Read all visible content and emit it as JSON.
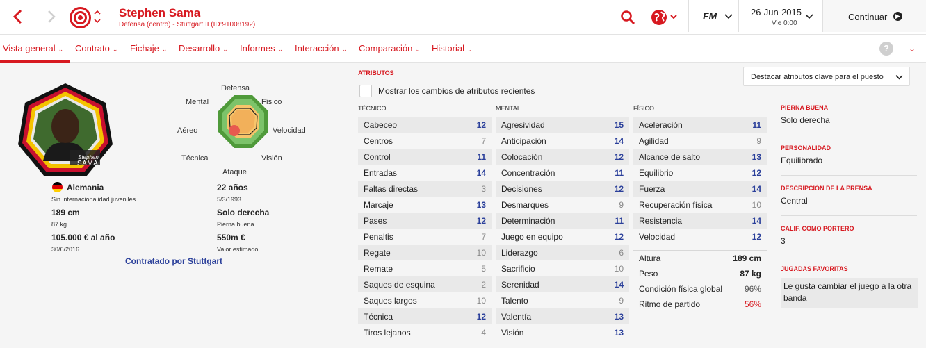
{
  "header": {
    "player_name": "Stephen Sama",
    "player_sub": "Defensa (centro) - Stuttgart II (ID:91008192)",
    "fm_label": "FM",
    "date": "26-Jun-2015",
    "day_time": "Vie 0:00",
    "continue_label": "Continuar"
  },
  "menu": {
    "items": [
      "Vista general",
      "Contrato",
      "Fichaje",
      "Desarrollo",
      "Informes",
      "Interacción",
      "Comparación",
      "Historial"
    ],
    "help": "?"
  },
  "profile": {
    "portrait_first": "Stephen",
    "portrait_last": "SAMA",
    "nationality": "Alemania",
    "youth_caps": "Sin internacionalidad juveniles",
    "height": "189 cm",
    "weight": "87 kg",
    "wage": "105.000 € al año",
    "contract_end": "30/6/2016",
    "age": "22 años",
    "dob": "5/3/1993",
    "foot": "Solo derecha",
    "foot_label": "Pierna buena",
    "value": "550m €",
    "value_label": "Valor estimado",
    "contracted": "Contratado por Stuttgart"
  },
  "radar": {
    "labels": {
      "defensa": "Defensa",
      "fisico": "Físico",
      "velocidad": "Velocidad",
      "vision": "Visión",
      "ataque": "Ataque",
      "tecnica": "Técnica",
      "aereo": "Aéreo",
      "mental": "Mental"
    }
  },
  "attributes": {
    "title": "ATRIBUTOS",
    "highlight_select": "Destacar atributos clave para el puesto",
    "show_changes": "Mostrar los cambios de atributos recientes",
    "technical_head": "TÉCNICO",
    "mental_head": "MENTAL",
    "physical_head": "FÍSICO",
    "technical": [
      {
        "name": "Cabeceo",
        "value": "12",
        "hl": true
      },
      {
        "name": "Centros",
        "value": "7",
        "hl": false
      },
      {
        "name": "Control",
        "value": "11",
        "hl": true
      },
      {
        "name": "Entradas",
        "value": "14",
        "hl": true
      },
      {
        "name": "Faltas directas",
        "value": "3",
        "hl": false
      },
      {
        "name": "Marcaje",
        "value": "13",
        "hl": true
      },
      {
        "name": "Pases",
        "value": "12",
        "hl": true
      },
      {
        "name": "Penaltis",
        "value": "7",
        "hl": false
      },
      {
        "name": "Regate",
        "value": "10",
        "hl": false
      },
      {
        "name": "Remate",
        "value": "5",
        "hl": false
      },
      {
        "name": "Saques de esquina",
        "value": "2",
        "hl": false
      },
      {
        "name": "Saques largos",
        "value": "10",
        "hl": false
      },
      {
        "name": "Técnica",
        "value": "12",
        "hl": true
      },
      {
        "name": "Tiros lejanos",
        "value": "4",
        "hl": false
      }
    ],
    "mental": [
      {
        "name": "Agresividad",
        "value": "15",
        "hl": true
      },
      {
        "name": "Anticipación",
        "value": "14",
        "hl": true
      },
      {
        "name": "Colocación",
        "value": "12",
        "hl": true
      },
      {
        "name": "Concentración",
        "value": "11",
        "hl": true
      },
      {
        "name": "Decisiones",
        "value": "12",
        "hl": true
      },
      {
        "name": "Desmarques",
        "value": "9",
        "hl": false
      },
      {
        "name": "Determinación",
        "value": "11",
        "hl": true
      },
      {
        "name": "Juego en equipo",
        "value": "12",
        "hl": true
      },
      {
        "name": "Liderazgo",
        "value": "6",
        "hl": false
      },
      {
        "name": "Sacrificio",
        "value": "10",
        "hl": false
      },
      {
        "name": "Serenidad",
        "value": "14",
        "hl": true
      },
      {
        "name": "Talento",
        "value": "9",
        "hl": false
      },
      {
        "name": "Valentía",
        "value": "13",
        "hl": true
      },
      {
        "name": "Visión",
        "value": "13",
        "hl": true
      }
    ],
    "physical": [
      {
        "name": "Aceleración",
        "value": "11",
        "hl": true
      },
      {
        "name": "Agilidad",
        "value": "9",
        "hl": false
      },
      {
        "name": "Alcance de salto",
        "value": "13",
        "hl": true
      },
      {
        "name": "Equilibrio",
        "value": "12",
        "hl": true
      },
      {
        "name": "Fuerza",
        "value": "14",
        "hl": true
      },
      {
        "name": "Recuperación física",
        "value": "10",
        "hl": false
      },
      {
        "name": "Resistencia",
        "value": "14",
        "hl": true
      },
      {
        "name": "Velocidad",
        "value": "12",
        "hl": true
      }
    ],
    "physical_extra": [
      {
        "name": "Altura",
        "value": "189 cm",
        "style": "dark"
      },
      {
        "name": "Peso",
        "value": "87 kg",
        "style": "dark"
      },
      {
        "name": "Condición física global",
        "value": "96%",
        "style": "norm"
      },
      {
        "name": "Ritmo de partido",
        "value": "56%",
        "style": "red"
      }
    ]
  },
  "right_info": {
    "foot_head": "PIERNA BUENA",
    "foot_val": "Solo derecha",
    "personality_head": "PERSONALIDAD",
    "personality_val": "Equilibrado",
    "press_head": "DESCRIPCIÓN DE LA PRENSA",
    "press_val": "Central",
    "gk_head": "CALIF. COMO PORTERO",
    "gk_val": "3",
    "fav_head": "JUGADAS FAVORITAS",
    "fav_val": "Le gusta cambiar el juego a la otra banda"
  },
  "colors": {
    "accent": "#d71920",
    "highlight_value": "#2a3f9a"
  }
}
